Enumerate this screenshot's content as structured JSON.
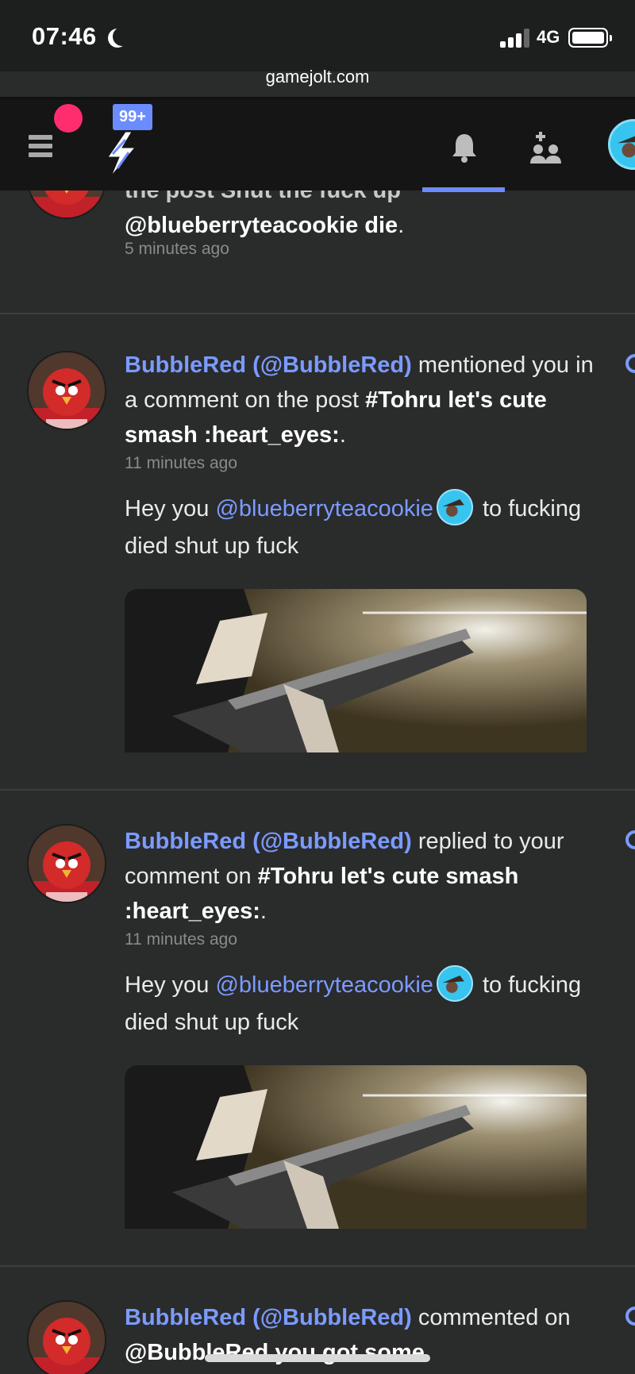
{
  "status": {
    "time": "07:46",
    "network": "4G",
    "url": "gamejolt.com"
  },
  "nav": {
    "badge": "99+",
    "accent": "#6b8cff",
    "dot_color": "#ff2d6e"
  },
  "notifications": [
    {
      "partial_line1": "the post Shut the fuck up",
      "partial_line2": "@blueberryteacookie die",
      "period": ".",
      "ago": "5 minutes ago"
    },
    {
      "user": "BubbleRed (@BubbleRed)",
      "action": " mentioned you in a comment on the post ",
      "target": "#Tohru let's cute smash :heart_eyes:",
      "period": ".",
      "ago": "11 minutes ago",
      "comment_prefix": "Hey you ",
      "comment_mention": "@blueberryteacookie",
      "comment_suffix": " to fucking died shut up fuck"
    },
    {
      "user": "BubbleRed (@BubbleRed)",
      "action": " replied to your comment on ",
      "target": "#Tohru let's cute smash :heart_eyes:",
      "period": ".",
      "ago": "11 minutes ago",
      "comment_prefix": "Hey you ",
      "comment_mention": "@blueberryteacookie",
      "comment_suffix": " to fucking died shut up fuck"
    },
    {
      "user": "BubbleRed (@BubbleRed)",
      "action": " commented on ",
      "target": "@BubbleRed you got some"
    }
  ]
}
